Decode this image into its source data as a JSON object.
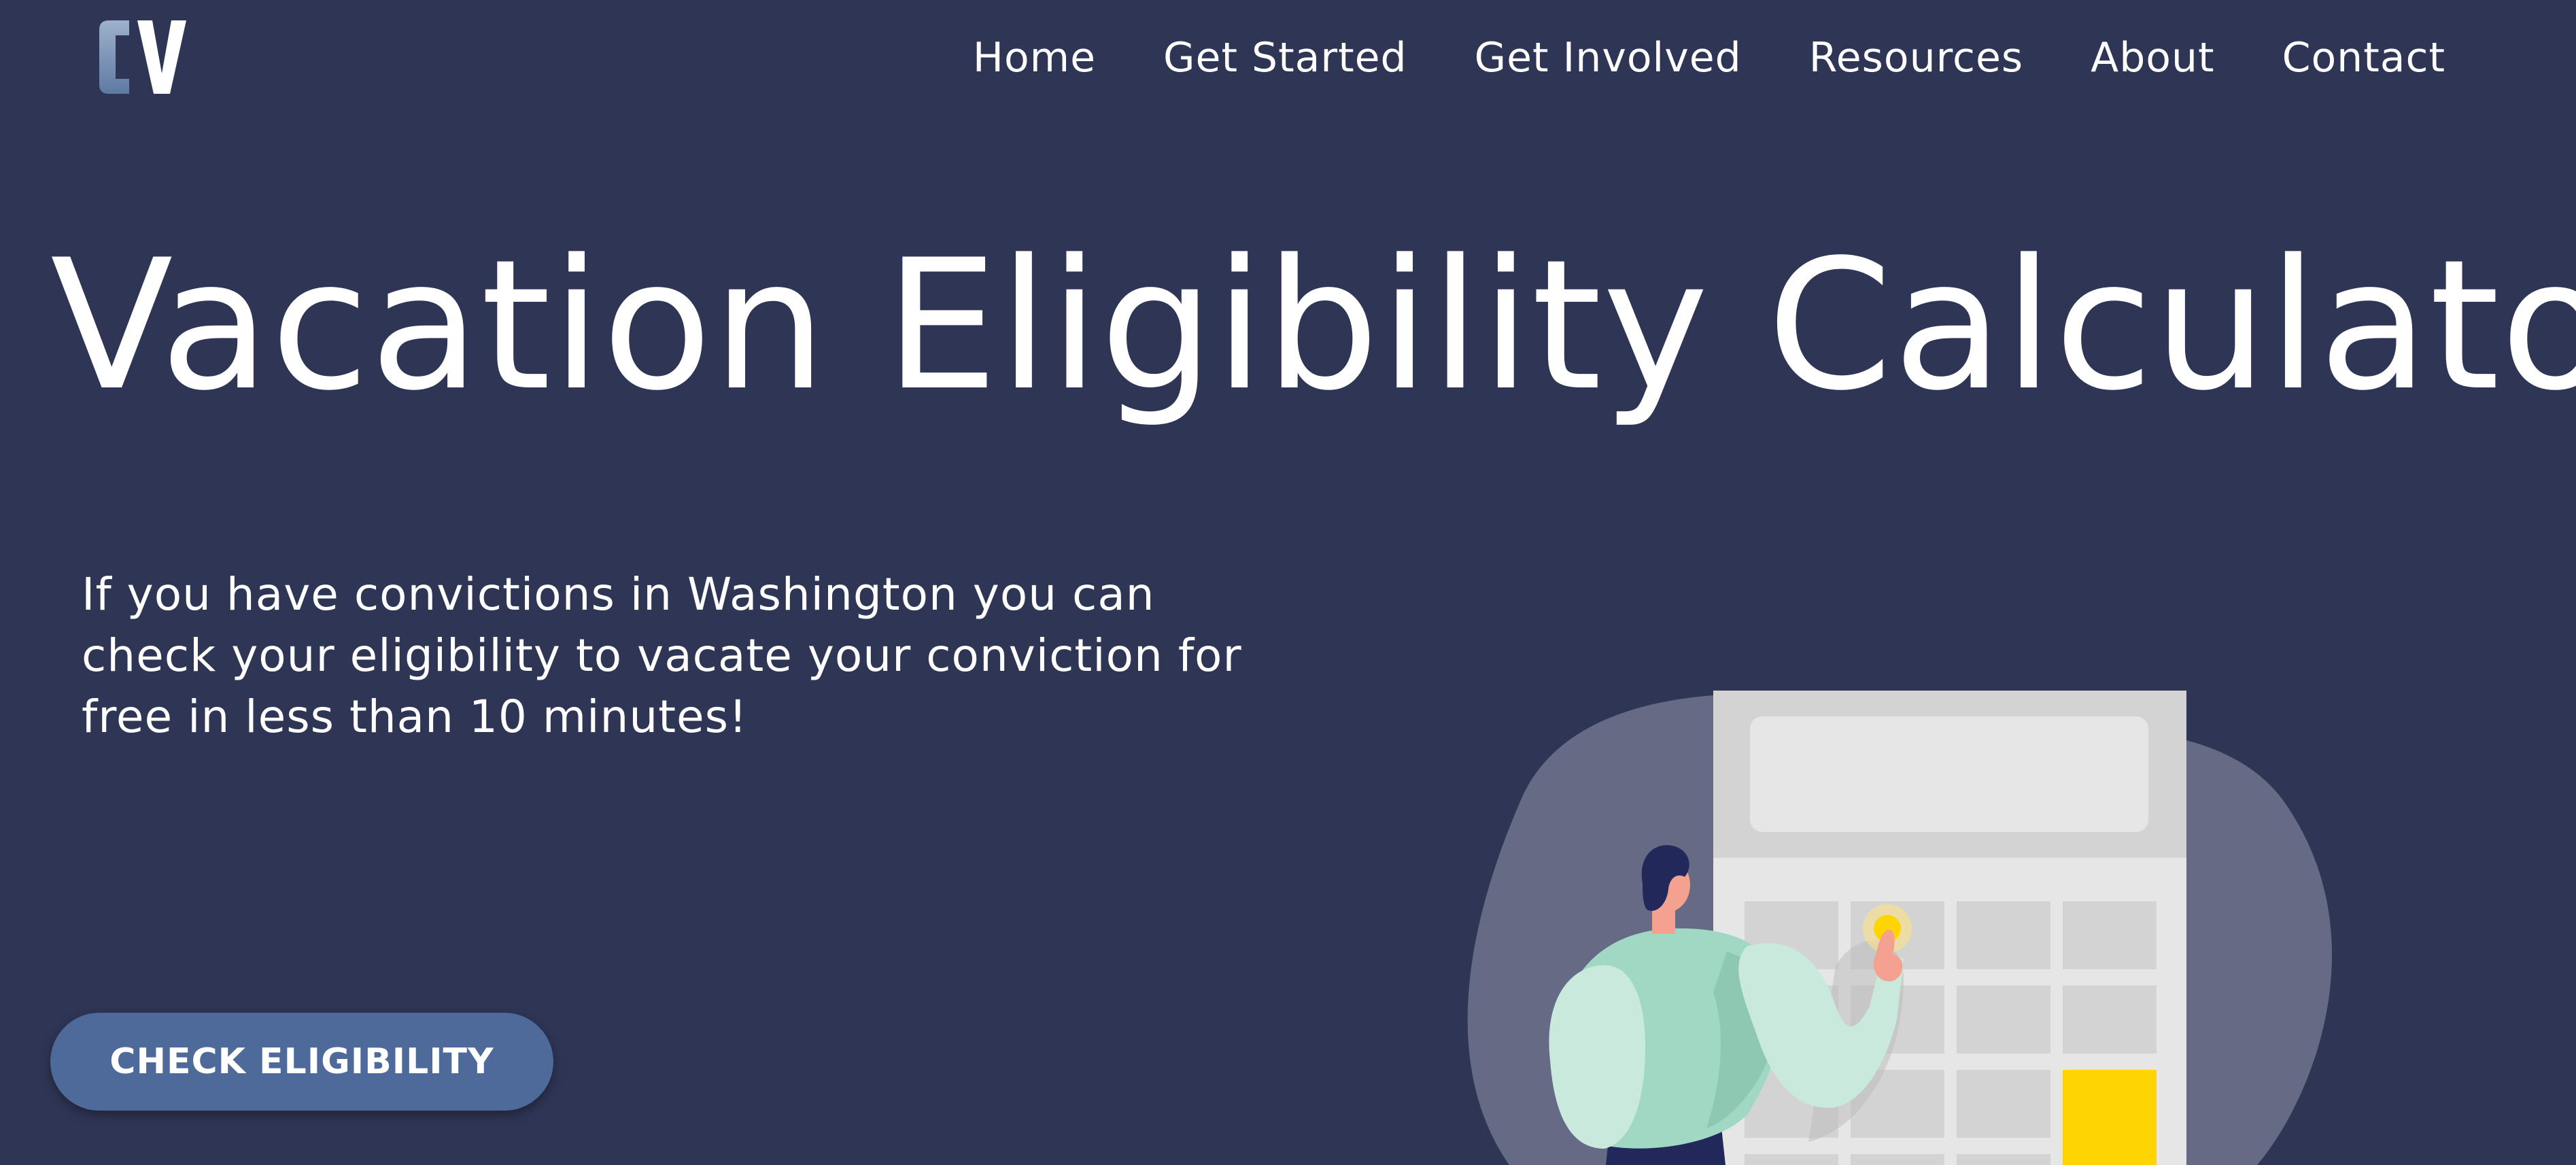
{
  "logo": {
    "text": "CV",
    "icon": "cv-logo-icon"
  },
  "nav": {
    "items": [
      {
        "label": "Home"
      },
      {
        "label": "Get Started"
      },
      {
        "label": "Get Involved"
      },
      {
        "label": "Resources"
      },
      {
        "label": "About"
      },
      {
        "label": "Contact"
      }
    ]
  },
  "hero": {
    "title": "Vacation Eligibility Calculator",
    "description": "If you have convictions in Washington you can check your eligibility to vacate your conviction for free in less than 10 minutes!",
    "cta_label": "CHECK ELIGIBILITY"
  },
  "illustration": {
    "icon": "person-pressing-calculator-illustration"
  },
  "colors": {
    "background": "#2f3555",
    "button": "#4d6a9a",
    "accent_yellow": "#ffd400",
    "shirt": "#a1d8c4"
  }
}
